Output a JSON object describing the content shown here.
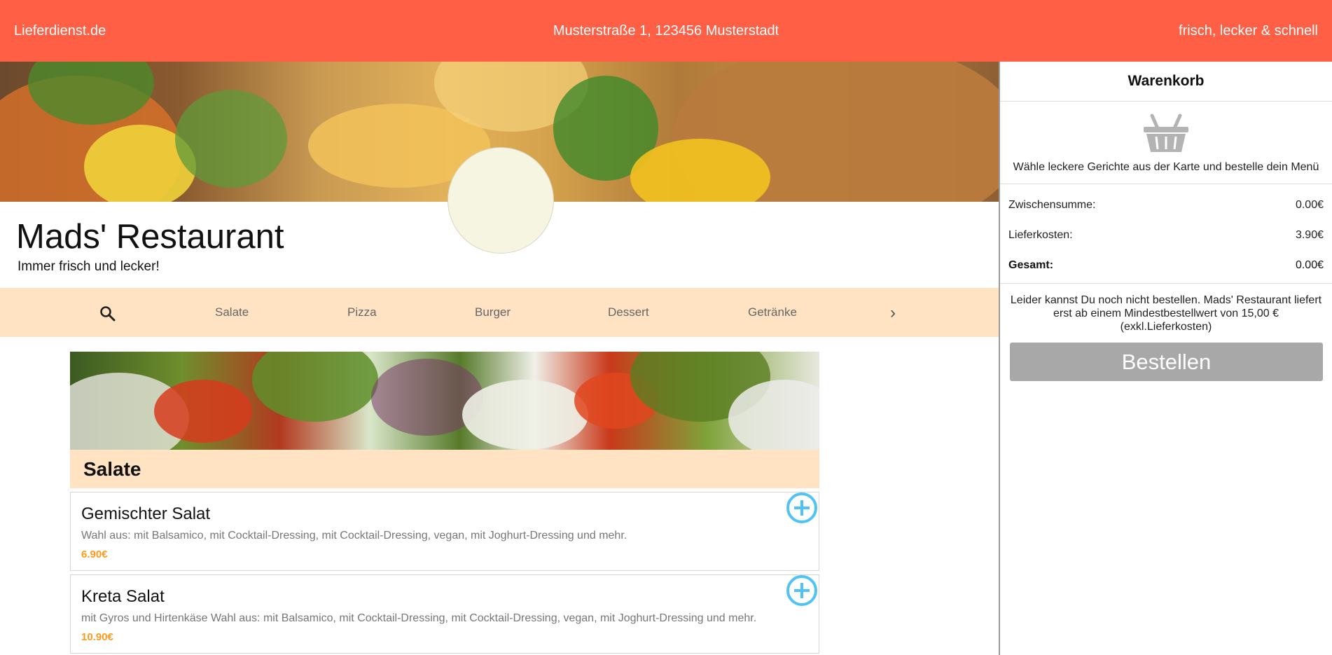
{
  "header": {
    "site_name": "Lieferdienst.de",
    "address": "Musterstraße 1, 123456 Musterstadt",
    "slogan": "frisch, lecker & schnell"
  },
  "restaurant": {
    "name": "Mads' Restaurant",
    "tagline": "Immer frisch und lecker!"
  },
  "category_nav": {
    "search_icon": "search-icon",
    "categories": [
      "Salate",
      "Pizza",
      "Burger",
      "Dessert",
      "Getränke"
    ],
    "next_icon": "chevron-right-icon"
  },
  "menu": {
    "section_title": "Salate",
    "items": [
      {
        "name": "Gemischter Salat",
        "description": "Wahl aus: mit Balsamico, mit Cocktail-Dressing, mit Cocktail-Dressing, vegan, mit Joghurt-Dressing und mehr.",
        "price": "6.90€"
      },
      {
        "name": "Kreta Salat",
        "description": "mit Gyros und Hirtenkäse Wahl aus: mit Balsamico, mit Cocktail-Dressing, mit Cocktail-Dressing, vegan, mit Joghurt-Dressing und mehr.",
        "price": "10.90€"
      }
    ]
  },
  "cart": {
    "title": "Warenkorb",
    "empty_icon": "basket-icon",
    "empty_message": "Wähle leckere Gerichte aus der Karte und bestelle dein Menü",
    "subtotal_label": "Zwischensumme:",
    "subtotal_value": "0.00€",
    "delivery_label": "Lieferkosten:",
    "delivery_value": "3.90€",
    "total_label": "Gesamt:",
    "total_value": "0.00€",
    "notice": "Leider kannst Du noch nicht bestellen. Mads' Restaurant liefert erst ab einem Mindestbestellwert von 15,00 € (exkl.Lieferkosten)",
    "order_button": "Bestellen"
  },
  "colors": {
    "header_bg": "#ff5f45",
    "nav_bg": "#ffe3c2",
    "price": "#ff9a1e",
    "add_icon": "#4fc3f7",
    "order_button_disabled": "#a8a8a8"
  }
}
